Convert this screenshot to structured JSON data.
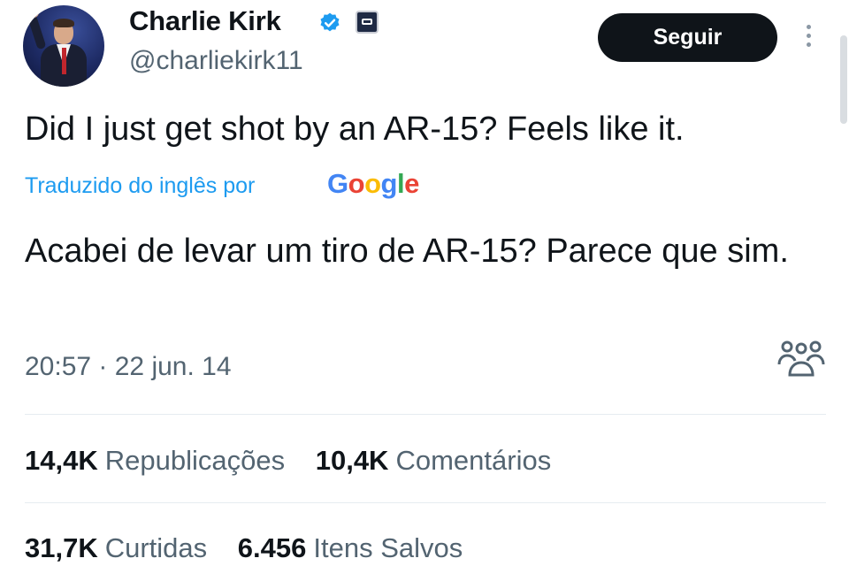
{
  "author": {
    "name": "Charlie Kirk",
    "handle": "@charliekirk11"
  },
  "actions": {
    "follow_label": "Seguir"
  },
  "tweet": {
    "text": "Did I just get shot by an AR-15? Feels like it.",
    "translated_label": "Traduzido do inglês por",
    "translator_brand": "Google",
    "translation": "Acabei de levar um tiro de AR-15? Parece que sim.",
    "timestamp": "20:57 · 22 jun. 14"
  },
  "stats": {
    "reposts": {
      "value": "14,4K",
      "label": "Republicações"
    },
    "comments": {
      "value": "10,4K",
      "label": "Comentários"
    },
    "likes": {
      "value": "31,7K",
      "label": "Curtidas"
    },
    "saves": {
      "value": "6.456",
      "label": "Itens Salvos"
    }
  },
  "colors": {
    "verified": "#1d9bf0",
    "link": "#1d9bf0",
    "secondary_text": "#536471"
  },
  "icons": {
    "verified": "verified-badge-icon",
    "affiliation": "affiliation-badge-icon",
    "more": "more-options-icon",
    "community": "community-icon"
  }
}
